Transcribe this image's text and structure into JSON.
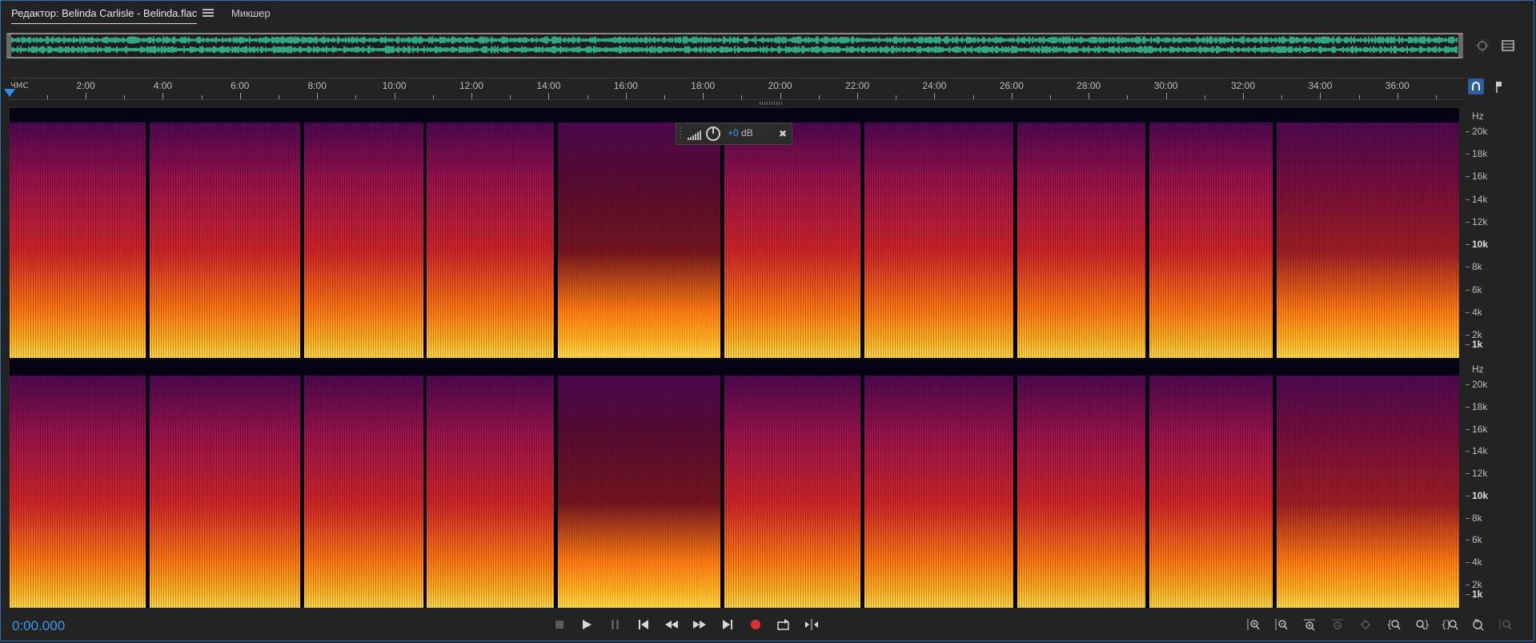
{
  "tabs": {
    "editor": "Редактор: Belinda Carlisle - Belinda.flac",
    "mixer": "Микшер"
  },
  "ruler": {
    "unit": "ЧМС",
    "labels": [
      "2:00",
      "4:00",
      "6:00",
      "8:00",
      "10:00",
      "12:00",
      "14:00",
      "16:00",
      "18:00",
      "20:00",
      "22:00",
      "24:00",
      "26:00",
      "28:00",
      "30:00",
      "32:00",
      "34:00",
      "36:00"
    ]
  },
  "hz": {
    "unit": "Hz",
    "labels": [
      "20k",
      "18k",
      "16k",
      "14k",
      "12k",
      "10k",
      "8k",
      "6k",
      "4k",
      "2k",
      "1k"
    ]
  },
  "hud": {
    "value": "+0",
    "unit": " dB"
  },
  "transport": {
    "timecode": "0:00.000"
  },
  "colors": {
    "accent": "#3a9af0",
    "waveform": "#3fe0b0",
    "record": "#e03030"
  }
}
